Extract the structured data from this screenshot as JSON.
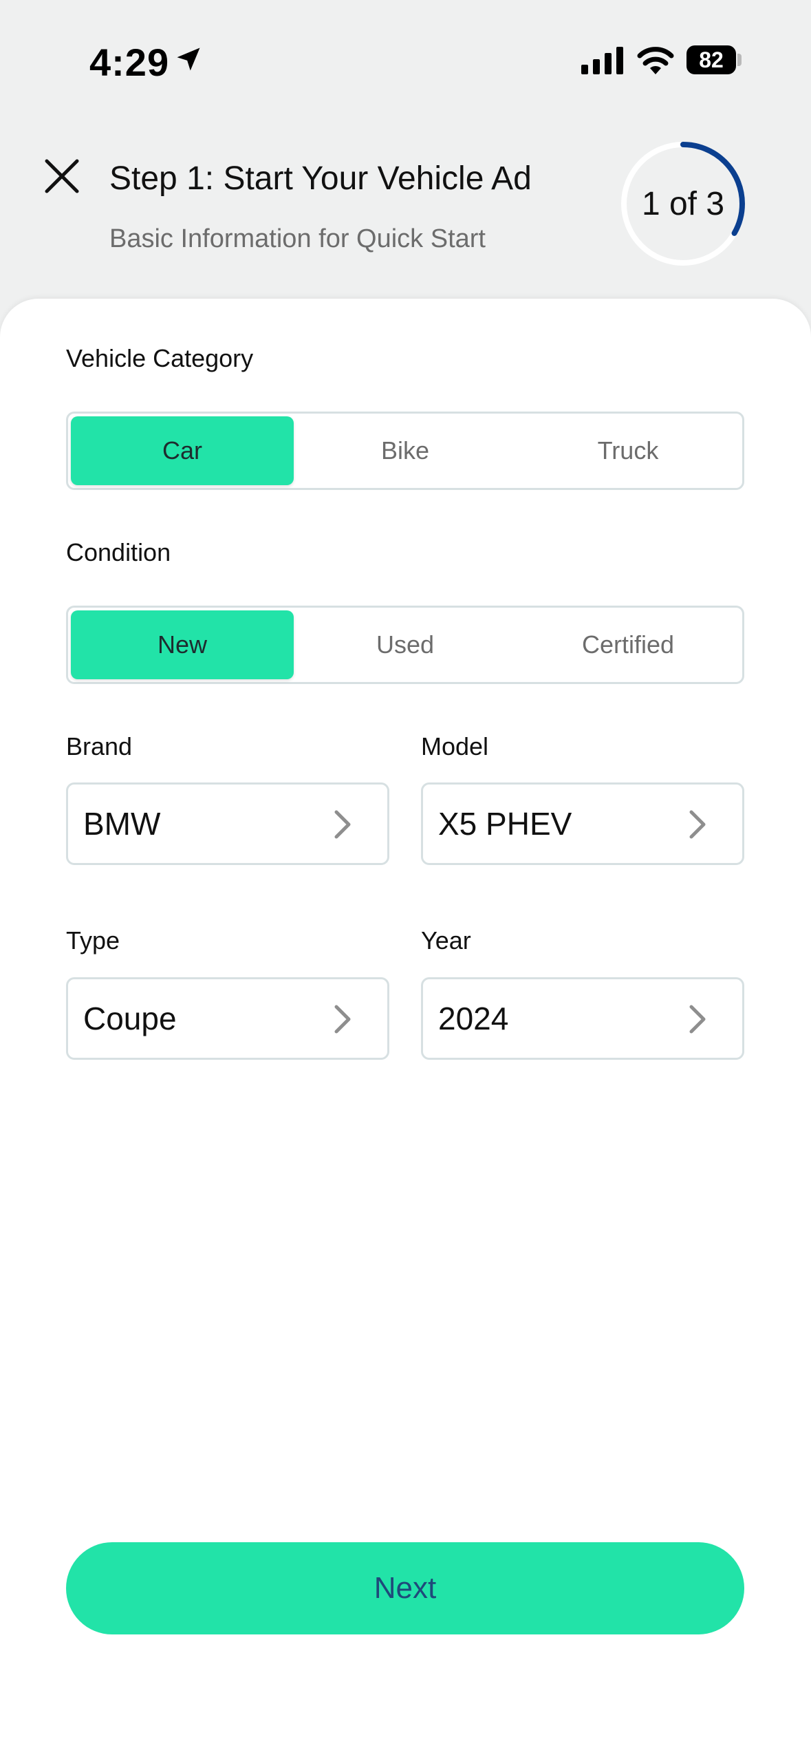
{
  "status_bar": {
    "time": "4:29",
    "battery": "82"
  },
  "header": {
    "title": "Step 1: Start Your Vehicle Ad",
    "subtitle": "Basic Information for Quick Start",
    "progress_text": "1 of 3",
    "progress_fraction": 0.333,
    "progress_color": "#0b3f8f"
  },
  "form": {
    "vehicle_category": {
      "label": "Vehicle Category",
      "options": [
        "Car",
        "Bike",
        "Truck"
      ],
      "selected": "Car"
    },
    "condition": {
      "label": "Condition",
      "options": [
        "New",
        "Used",
        "Certified"
      ],
      "selected": "New"
    },
    "brand": {
      "label": "Brand",
      "value": "BMW"
    },
    "model": {
      "label": "Model",
      "value": "X5 PHEV"
    },
    "type": {
      "label": "Type",
      "value": "Coupe"
    },
    "year": {
      "label": "Year",
      "value": "2024"
    }
  },
  "next_button": {
    "label": "Next"
  },
  "colors": {
    "accent": "#22e3a8",
    "next_text": "#1f4a7a",
    "background": "#eff0f0"
  },
  "icons": [
    "location-arrow-icon",
    "cellular-signal-icon",
    "wifi-icon",
    "battery-icon",
    "close-icon",
    "chevron-right-icon"
  ]
}
